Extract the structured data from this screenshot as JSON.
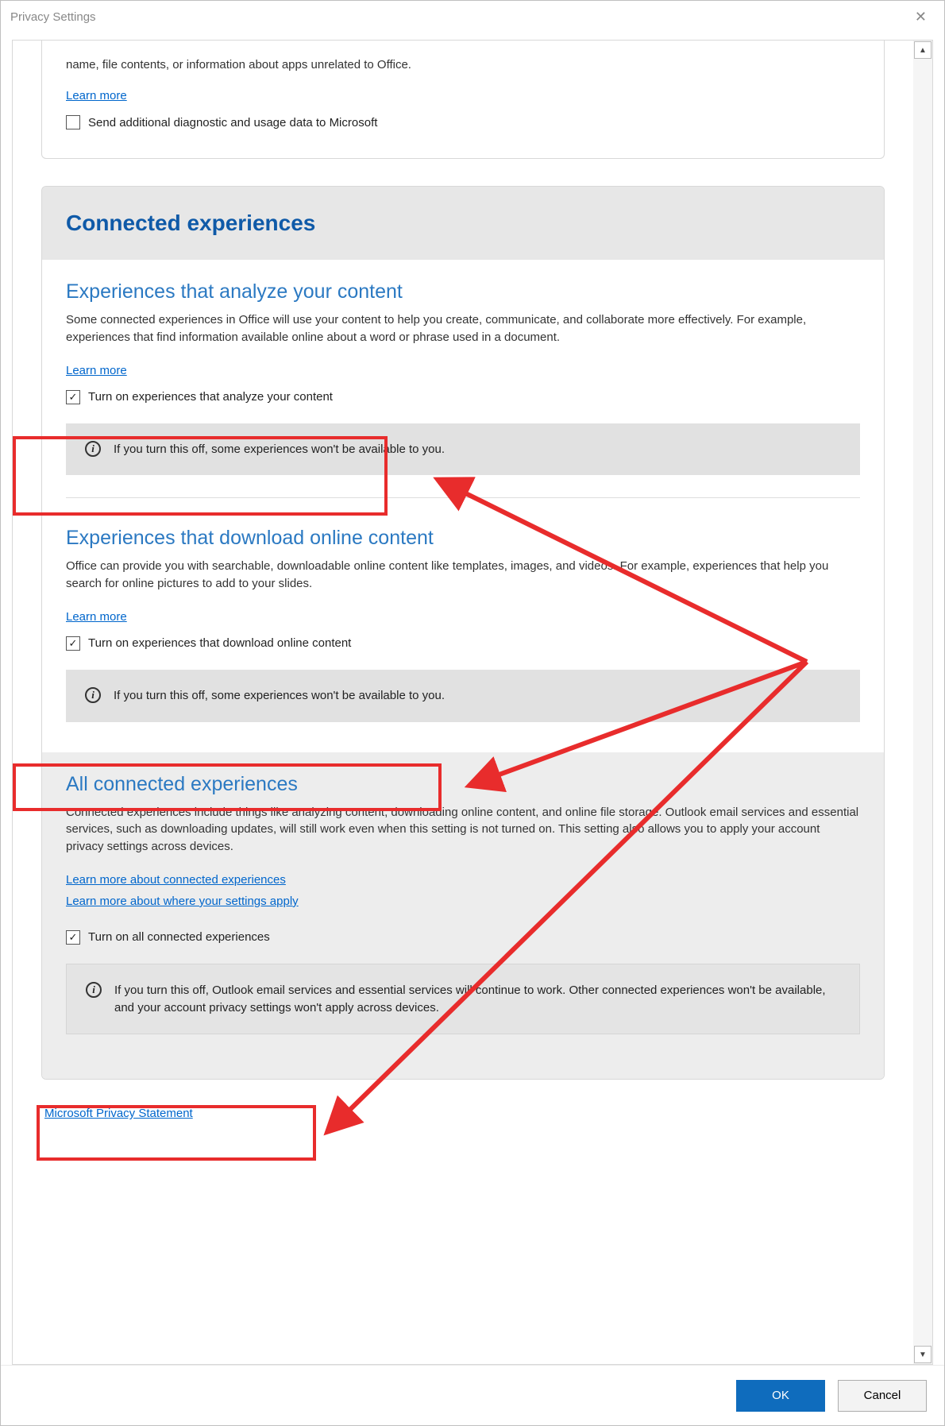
{
  "window": {
    "title": "Privacy Settings"
  },
  "truncated_card": {
    "text": "name, file contents, or information about apps unrelated to Office.",
    "learn_more": "Learn more",
    "checkbox_label": "Send additional diagnostic and usage data to Microsoft"
  },
  "connected": {
    "header": "Connected experiences",
    "analyze": {
      "heading": "Experiences that analyze your content",
      "desc": "Some connected experiences in Office will use your content to help you create, communicate, and collaborate more effectively. For example, experiences that find information available online about a word or phrase used in a document.",
      "learn_more": "Learn more",
      "checkbox_label": "Turn on experiences that analyze your content",
      "info": "If you turn this off, some experiences won't be available to you."
    },
    "download": {
      "heading": "Experiences that download online content",
      "desc": "Office can provide you with searchable, downloadable online content like templates, images, and videos. For example, experiences that help you search for online pictures to add to your slides.",
      "learn_more": "Learn more",
      "checkbox_label": "Turn on experiences that download online content",
      "info": "If you turn this off, some experiences won't be available to you."
    },
    "all": {
      "heading": "All connected experiences",
      "desc": "Connected experiences include things like analyzing content, downloading online content, and online file storage. Outlook email services and essential services, such as downloading updates, will still work even when this setting is not turned on. This setting also allows you to apply your account privacy settings across devices.",
      "learn_more_1": "Learn more about connected experiences",
      "learn_more_2": "Learn more about where your settings apply",
      "checkbox_label": "Turn on all connected experiences",
      "info": "If you turn this off, Outlook email services and essential services will continue to work. Other connected experiences won't be available, and your account privacy settings won't apply across devices."
    }
  },
  "bottom_link": "Microsoft Privacy Statement",
  "buttons": {
    "ok": "OK",
    "cancel": "Cancel"
  }
}
